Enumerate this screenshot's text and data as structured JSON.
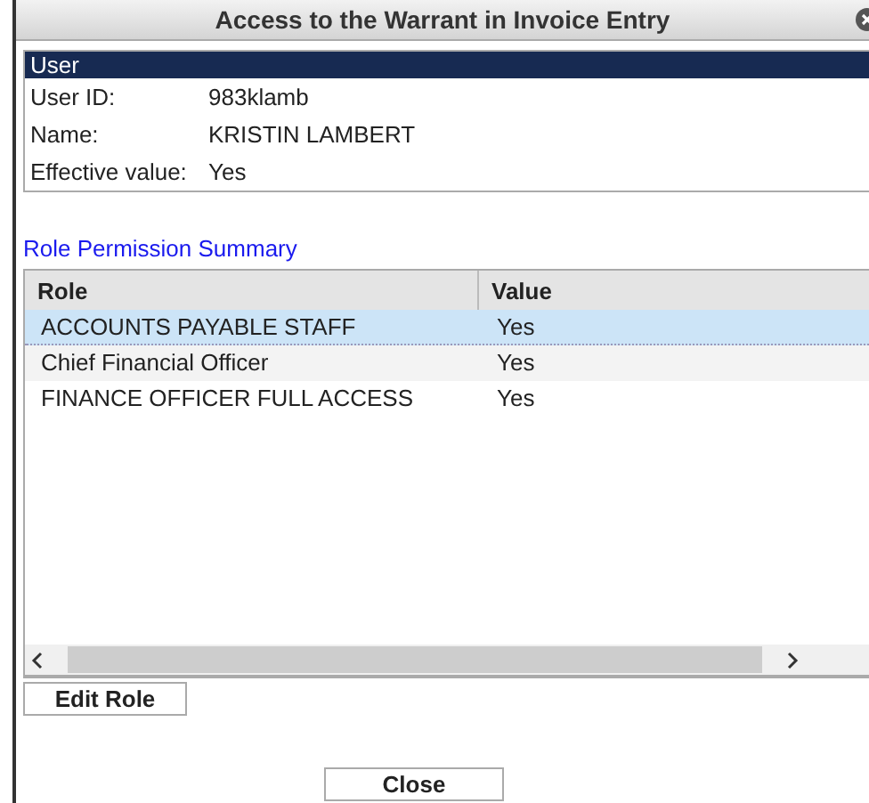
{
  "window": {
    "title": "Access to the Warrant in Invoice Entry"
  },
  "user_panel": {
    "title": "User",
    "fields": [
      {
        "label": "User ID:",
        "value": "983klamb"
      },
      {
        "label": "Name:",
        "value": "KRISTIN LAMBERT"
      },
      {
        "label": "Effective value:",
        "value": "Yes"
      }
    ]
  },
  "summary": {
    "title": "Role Permission Summary",
    "columns": [
      "Role",
      "Value"
    ],
    "rows": [
      {
        "role": "ACCOUNTS PAYABLE STAFF",
        "value": "Yes",
        "selected": true
      },
      {
        "role": "Chief Financial Officer",
        "value": "Yes",
        "selected": false
      },
      {
        "role": "FINANCE OFFICER FULL ACCESS",
        "value": "Yes",
        "selected": false
      }
    ]
  },
  "buttons": [
    {
      "label": "Edit Role",
      "kind": "panel"
    },
    {
      "label": "Close",
      "kind": "footer"
    }
  ]
}
